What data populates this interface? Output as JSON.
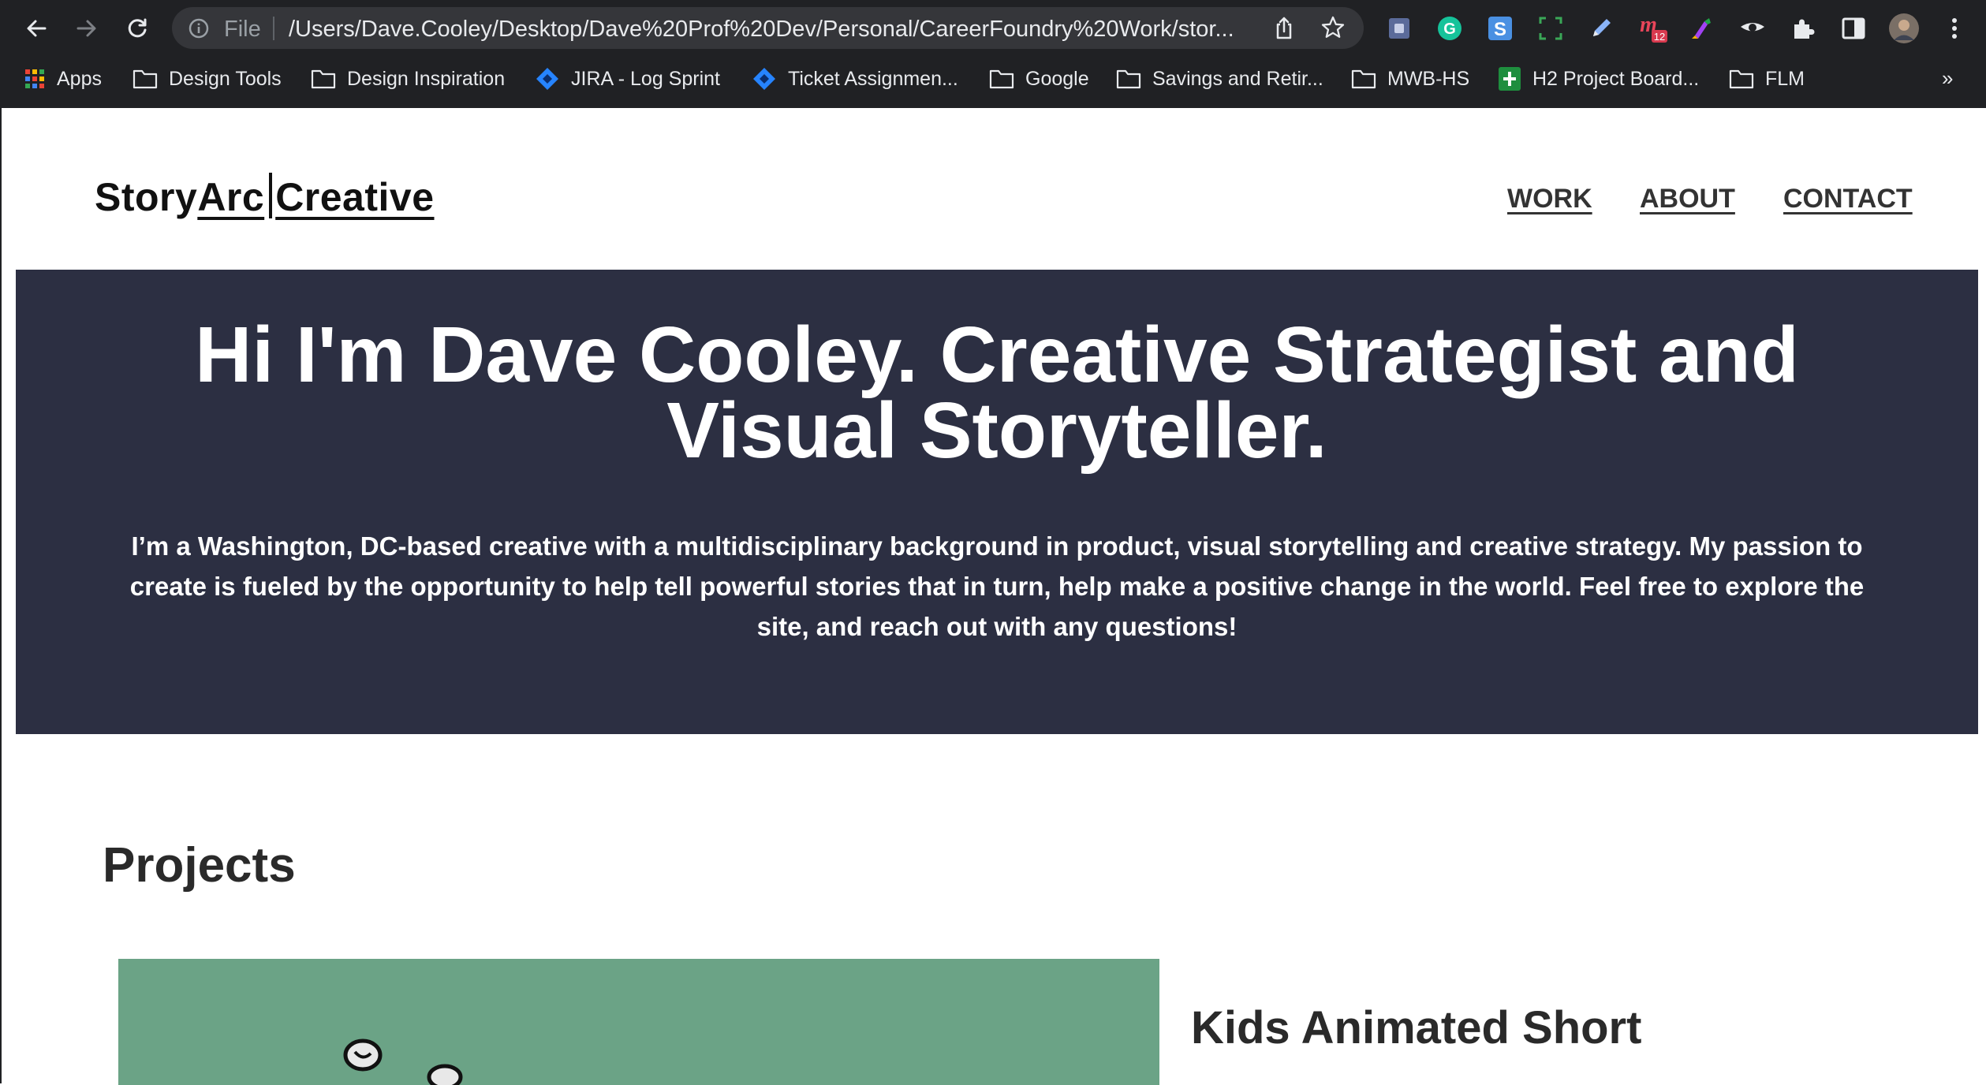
{
  "browser": {
    "address_scheme": "File",
    "url": "/Users/Dave.Cooley/Desktop/Dave%20Prof%20Dev/Personal/CareerFoundry%20Work/stor...",
    "extension_badge": "12",
    "bookmarks": [
      {
        "label": "Apps",
        "icon": "apps-grid-icon"
      },
      {
        "label": "Design Tools",
        "icon": "folder-icon"
      },
      {
        "label": "Design Inspiration",
        "icon": "folder-icon"
      },
      {
        "label": "JIRA - Log Sprint",
        "icon": "jira-icon"
      },
      {
        "label": "Ticket Assignmen...",
        "icon": "jira-icon"
      },
      {
        "label": "Google",
        "icon": "folder-icon"
      },
      {
        "label": "Savings and Retir...",
        "icon": "folder-icon"
      },
      {
        "label": "MWB-HS",
        "icon": "folder-icon"
      },
      {
        "label": "H2 Project Board...",
        "icon": "sheets-icon"
      },
      {
        "label": "FLM",
        "icon": "folder-icon"
      }
    ],
    "more_bookmarks": "»"
  },
  "site": {
    "logo": {
      "part1": "Story",
      "part2": "Arc",
      "part3": "Creative"
    },
    "nav": {
      "work": "WORK",
      "about": "ABOUT",
      "contact": "CONTACT"
    }
  },
  "hero": {
    "title_line1": "Hi I'm Dave Cooley. Creative Strategist and",
    "title_line2": "Visual Storyteller.",
    "body": "I’m a Washington, DC-based creative with a multidisciplinary background in product, visual storytelling and creative strategy. My passion to create is fueled by the opportunity to help tell powerful stories that in turn, help make a positive change in the world. Feel free to explore the site, and reach out with any questions!"
  },
  "projects": {
    "heading": "Projects",
    "items": [
      {
        "title": "Kids Animated Short",
        "image_color": "#6ba386"
      }
    ]
  },
  "colors": {
    "chrome_bg": "#202124",
    "omnibox_bg": "#35363a",
    "hero_bg": "#2c2f42",
    "project_bg": "#6ba386"
  }
}
